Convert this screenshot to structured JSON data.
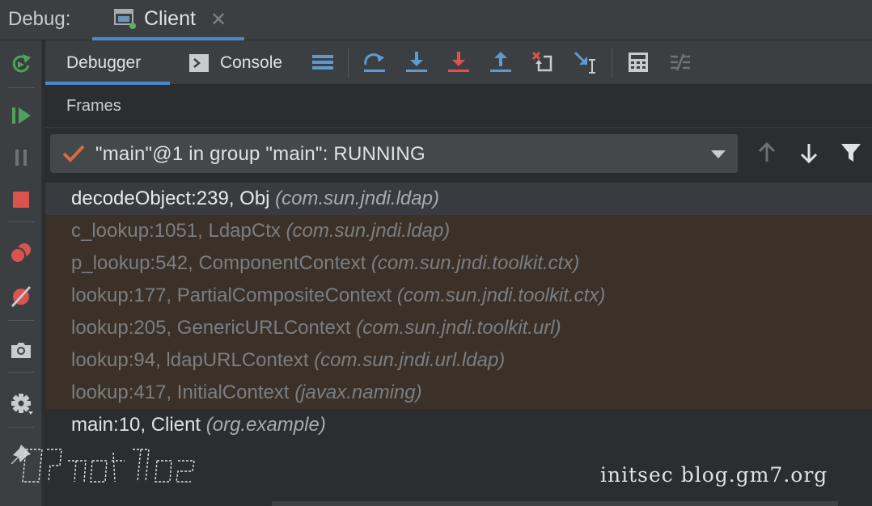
{
  "topbar": {
    "debug_label": "Debug:",
    "tab_label": "Client",
    "close_glyph": "✕",
    "icons": [
      "window-icon",
      "close-icon"
    ]
  },
  "left_toolbar": {
    "icons": [
      "rerun-icon",
      "resume-icon",
      "pause-icon",
      "stop-icon",
      "view-breakpoints-icon",
      "mute-breakpoints-icon",
      "camera-icon",
      "settings-icon",
      "pin-icon"
    ]
  },
  "tabs": {
    "debugger": "Debugger",
    "console": "Console"
  },
  "toolbar_icons": [
    "threads-list-icon",
    "step-over-icon",
    "step-into-icon",
    "force-step-into-icon",
    "step-out-icon",
    "drop-frame-icon",
    "run-to-cursor-icon",
    "evaluate-expression-icon",
    "trace-icon"
  ],
  "frames": {
    "header": "Frames",
    "thread": "\"main\"@1 in group \"main\": RUNNING",
    "rows": [
      {
        "method": "decodeObject:239, Obj ",
        "pkg": "(com.sun.jndi.ldap)",
        "kind": "selected"
      },
      {
        "method": "c_lookup:1051, LdapCtx ",
        "pkg": "(com.sun.jndi.ldap)",
        "kind": "lib"
      },
      {
        "method": "p_lookup:542, ComponentContext ",
        "pkg": "(com.sun.jndi.toolkit.ctx)",
        "kind": "lib"
      },
      {
        "method": "lookup:177, PartialCompositeContext ",
        "pkg": "(com.sun.jndi.toolkit.ctx)",
        "kind": "lib"
      },
      {
        "method": "lookup:205, GenericURLContext ",
        "pkg": "(com.sun.jndi.toolkit.url)",
        "kind": "lib"
      },
      {
        "method": "lookup:94, ldapURLContext ",
        "pkg": "(com.sun.jndi.url.ldap)",
        "kind": "lib"
      },
      {
        "method": "lookup:417, InitialContext ",
        "pkg": "(javax.naming)",
        "kind": "lib"
      },
      {
        "method": "main:10, Client ",
        "pkg": "(org.example)",
        "kind": "normal"
      }
    ]
  },
  "watermark": "initsec blog.gm7.org",
  "colors": {
    "accent": "#4a88c7",
    "library_row": "#3b3128",
    "rerun_green": "#4ea35a",
    "stop_red": "#d9534f",
    "check_orange": "#d86a3c"
  }
}
